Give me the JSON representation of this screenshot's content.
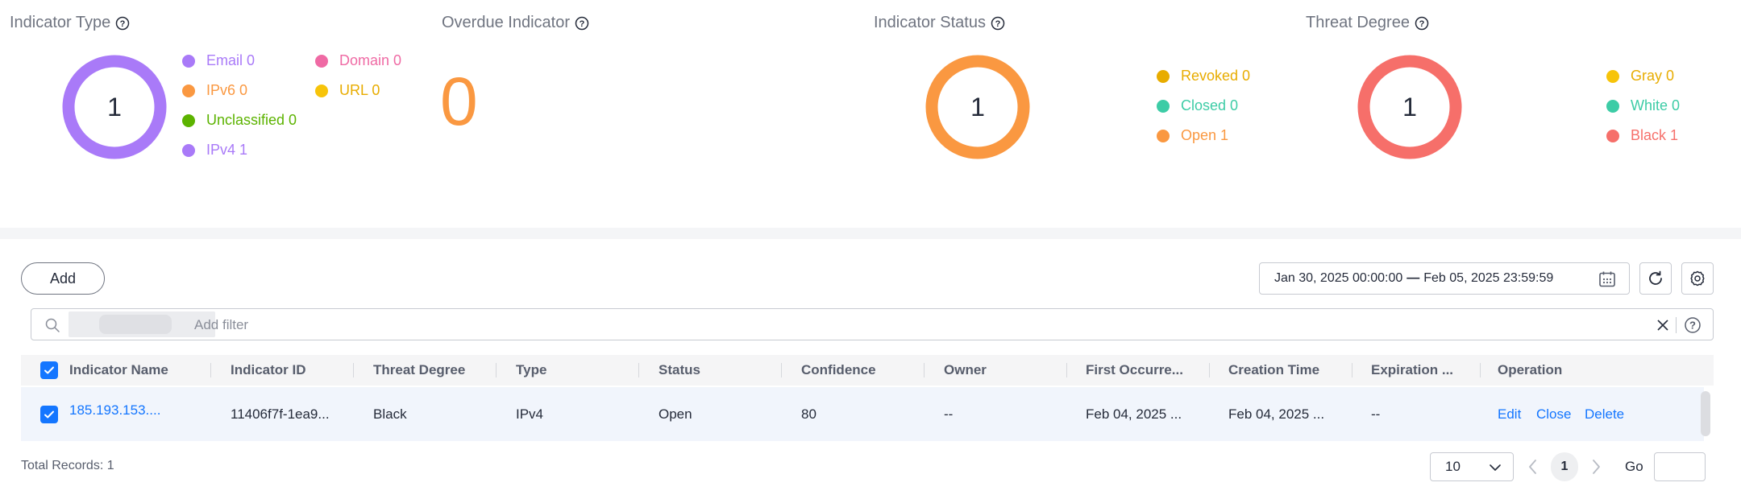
{
  "panels": {
    "indicator_type": {
      "title": "Indicator Type",
      "total": "1",
      "legend": [
        {
          "label": "Email 0",
          "color": "#a97af8"
        },
        {
          "label": "IPv6 0",
          "color": "#fa9841"
        },
        {
          "label": "Unclassified 0",
          "color": "#5cb300"
        },
        {
          "label": "IPv4 1",
          "color": "#a97af8"
        },
        {
          "label": "Domain 0",
          "color": "#ef6aa4"
        },
        {
          "label": "URL 0",
          "color": "#f7c40a"
        }
      ],
      "ring_color": "#a97af8"
    },
    "overdue_indicator": {
      "title": "Overdue Indicator",
      "value": "0"
    },
    "indicator_status": {
      "title": "Indicator Status",
      "total": "1",
      "legend": [
        {
          "label": "Revoked 0",
          "color": "#e8ac00"
        },
        {
          "label": "Closed 0",
          "color": "#3dcca6"
        },
        {
          "label": "Open 1",
          "color": "#fa9841"
        }
      ],
      "ring_color": "#fa9841"
    },
    "threat_degree": {
      "title": "Threat Degree",
      "total": "1",
      "legend": [
        {
          "label": "Gray 0",
          "color": "#f7c40a"
        },
        {
          "label": "White 0",
          "color": "#3dcca6"
        },
        {
          "label": "Black 1",
          "color": "#f66f6a"
        }
      ],
      "ring_color": "#f66f6a"
    }
  },
  "toolbar": {
    "add_label": "Add",
    "date_start": "Jan 30, 2025 00:00:00",
    "date_sep": "—",
    "date_end": "Feb 05, 2025 23:59:59"
  },
  "filter": {
    "placeholder": "Add filter"
  },
  "table": {
    "columns": [
      "Indicator Name",
      "Indicator ID",
      "Threat Degree",
      "Type",
      "Status",
      "Confidence",
      "Owner",
      "First Occurre...",
      "Creation Time",
      "Expiration ...",
      "Operation"
    ],
    "rows": [
      {
        "name": "185.193.153....",
        "id": "11406f7f-1ea9...",
        "threat_degree": "Black",
        "type": "IPv4",
        "status": "Open",
        "confidence": "80",
        "owner": "--",
        "first_occurred": "Feb 04, 2025 ...",
        "creation_time": "Feb 04, 2025 ...",
        "expiration": "--",
        "operations": [
          "Edit",
          "Close",
          "Delete"
        ]
      }
    ]
  },
  "footer": {
    "total_records": "Total Records: 1",
    "page_size": "10",
    "current_page": "1",
    "go_label": "Go"
  }
}
